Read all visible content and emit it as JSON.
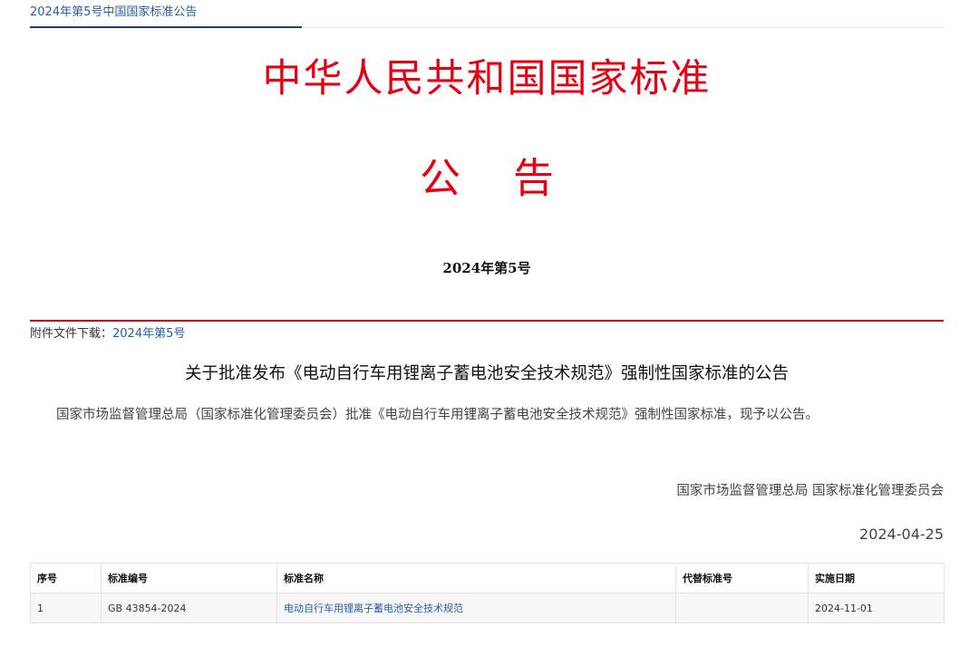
{
  "top_tab": {
    "label": "2024年第5号中国国家标准公告"
  },
  "header": {
    "title": "中华人民共和国国家标准",
    "notice_char_1": "公",
    "notice_char_2": "告",
    "issue_number": "2024年第5号"
  },
  "attachment": {
    "label": "附件文件下载：",
    "link_text": "2024年第5号"
  },
  "notice": {
    "title": "关于批准发布《电动自行车用锂离子蓄电池安全技术规范》强制性国家标准的公告",
    "body": "国家市场监督管理总局（国家标准化管理委员会）批准《电动自行车用锂离子蓄电池安全技术规范》强制性国家标准，现予以公告。",
    "signatory": "国家市场监督管理总局 国家标准化管理委员会",
    "date": "2024-04-25"
  },
  "table": {
    "headers": [
      "序号",
      "标准编号",
      "标准名称",
      "代替标准号",
      "实施日期"
    ],
    "rows": [
      {
        "index": "1",
        "code": "GB 43854-2024",
        "name": "电动自行车用锂离子蓄电池安全技术规范",
        "replaces": "",
        "effective_date": "2024-11-01"
      }
    ]
  },
  "colors": {
    "header_red": "#e60012",
    "link_blue": "#2a5d9f",
    "tab_underline": "#1f3d6b"
  }
}
